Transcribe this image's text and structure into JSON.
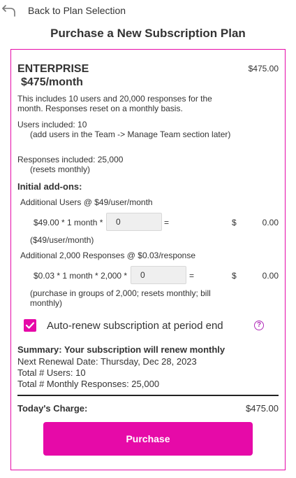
{
  "nav": {
    "back_label": "Back to Plan Selection",
    "back_icon": "undo-arrow-icon"
  },
  "page_title": "Purchase a New Subscription Plan",
  "plan": {
    "name": "ENTERPRISE",
    "price": "$475/month",
    "amount": "$475.00",
    "description": "This includes 10 users and 20,000 responses for the month. Responses reset on a monthly basis.",
    "users_included": "Users included: 10",
    "users_note": "(add users in the Team -> Manage Team section later)",
    "responses_included": "Responses included: 25,000",
    "responses_note": "(resets monthly)"
  },
  "addons": {
    "title": "Initial add-ons:",
    "users": {
      "label": "Additional Users @ $49/user/month",
      "formula": "$49.00 * 1 month *",
      "quantity": "0",
      "equals": "=",
      "currency": "$",
      "total": "0.00",
      "note": "($49/user/month)"
    },
    "responses": {
      "label": "Additional 2,000 Responses @ $0.03/response",
      "formula": "$0.03 * 1 month * 2,000 *",
      "quantity": "0",
      "equals": "=",
      "currency": "$",
      "total": "0.00",
      "note": "(purchase in groups of 2,000; resets monthly; bill monthly)"
    }
  },
  "auto_renew": {
    "checked": true,
    "label": "Auto-renew subscription at period end",
    "help_icon": "?"
  },
  "summary": {
    "title": "Summary: Your subscription will renew monthly",
    "renewal": "Next Renewal Date: Thursday, Dec 28, 2023",
    "users": "Total # Users: 10",
    "responses": "Total # Monthly Responses: 25,000"
  },
  "charge": {
    "label": "Today's Charge:",
    "value": "$475.00"
  },
  "purchase_label": "Purchase",
  "colors": {
    "accent": "#e60aa8",
    "help": "#b02ab8",
    "text": "#333333"
  }
}
